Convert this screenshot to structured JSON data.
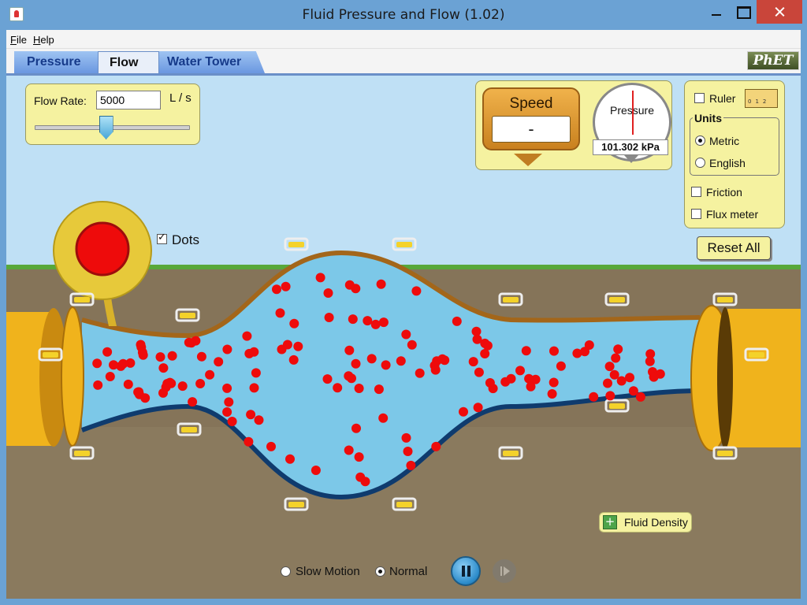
{
  "window": {
    "title": "Fluid Pressure and Flow (1.02)"
  },
  "menu": {
    "file": "File",
    "help": "Help"
  },
  "tabs": [
    {
      "label": "Pressure",
      "selected": false
    },
    {
      "label": "Flow",
      "selected": true
    },
    {
      "label": "Water Tower",
      "selected": false
    }
  ],
  "logo": "PhET",
  "flow_control": {
    "label": "Flow Rate:",
    "value": "5000",
    "unit": "L / s",
    "slider_fraction": 0.46
  },
  "speed_tool": {
    "label": "Speed",
    "value": "-"
  },
  "pressure_tool": {
    "label": "Pressure",
    "value": "101.302 kPa"
  },
  "options": {
    "ruler": {
      "label": "Ruler",
      "checked": false
    },
    "units": {
      "title": "Units",
      "metric": {
        "label": "Metric",
        "selected": true
      },
      "english": {
        "label": "English",
        "selected": false
      }
    },
    "friction": {
      "label": "Friction",
      "checked": false
    },
    "flux_meter": {
      "label": "Flux meter",
      "checked": false
    }
  },
  "reset_button": "Reset All",
  "dots": {
    "label": "Dots",
    "checked": true
  },
  "fluid_density_button": "Fluid Density",
  "playback": {
    "slow_motion": {
      "label": "Slow Motion",
      "selected": false
    },
    "normal": {
      "label": "Normal",
      "selected": true
    }
  },
  "colors": {
    "sky": "#bfe0f5",
    "ground": "#8a7a5e",
    "water": "#7cc8e8",
    "pipe_top": "#a3661a",
    "pipe_bottom": "#0f3b6e",
    "fixture_gold": "#f0b31c",
    "particle": "#ee0b0b",
    "panel": "#f5f2a0"
  }
}
